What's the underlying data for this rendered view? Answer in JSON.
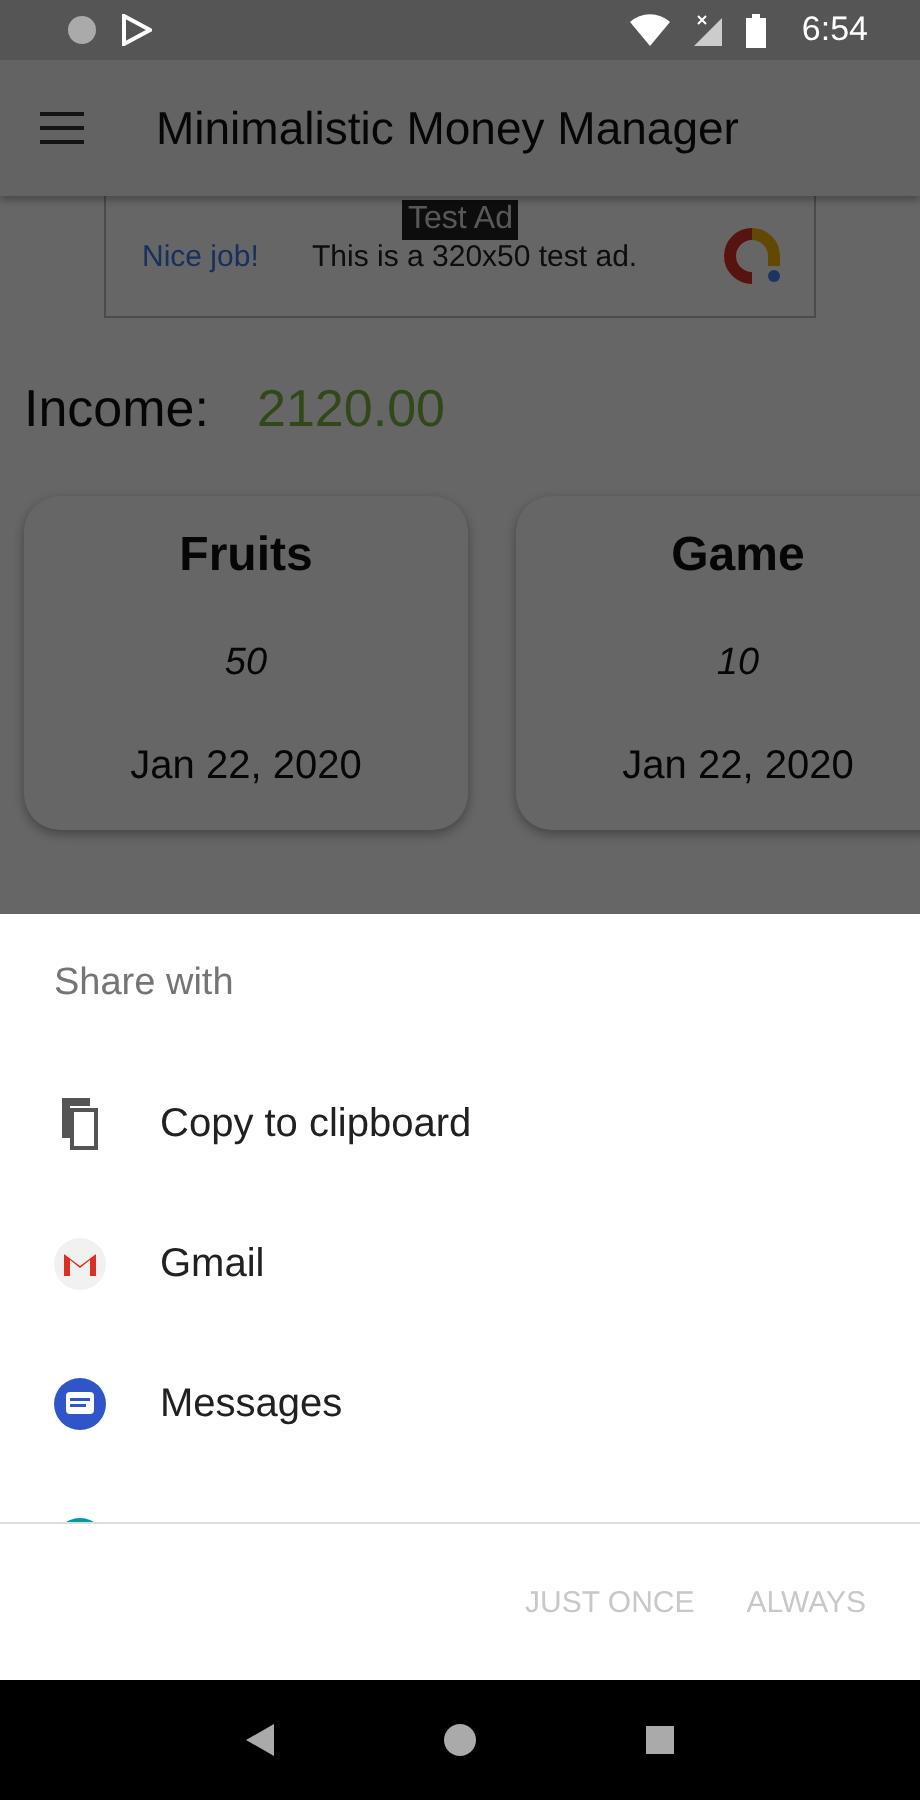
{
  "status_bar": {
    "time": "6:54"
  },
  "app_bar": {
    "title": "Minimalistic Money Manager"
  },
  "ad": {
    "badge": "Test Ad",
    "headline": "Nice job!",
    "text": "This is a 320x50 test ad."
  },
  "income": {
    "label": "Income:",
    "amount": "2120.00"
  },
  "income_cards": [
    {
      "title": "Fruits",
      "amount": "50",
      "date": "Jan 22, 2020"
    },
    {
      "title": "Game",
      "amount": "10",
      "date": "Jan 22, 2020"
    }
  ],
  "share_sheet": {
    "title": "Share with",
    "items": [
      {
        "kind": "copy",
        "label": "Copy to clipboard"
      },
      {
        "kind": "gmail",
        "label": "Gmail"
      },
      {
        "kind": "messages",
        "label": "Messages"
      }
    ],
    "buttons": [
      {
        "label": "JUST ONCE",
        "disabled": true
      },
      {
        "label": "ALWAYS",
        "disabled": true
      }
    ]
  }
}
